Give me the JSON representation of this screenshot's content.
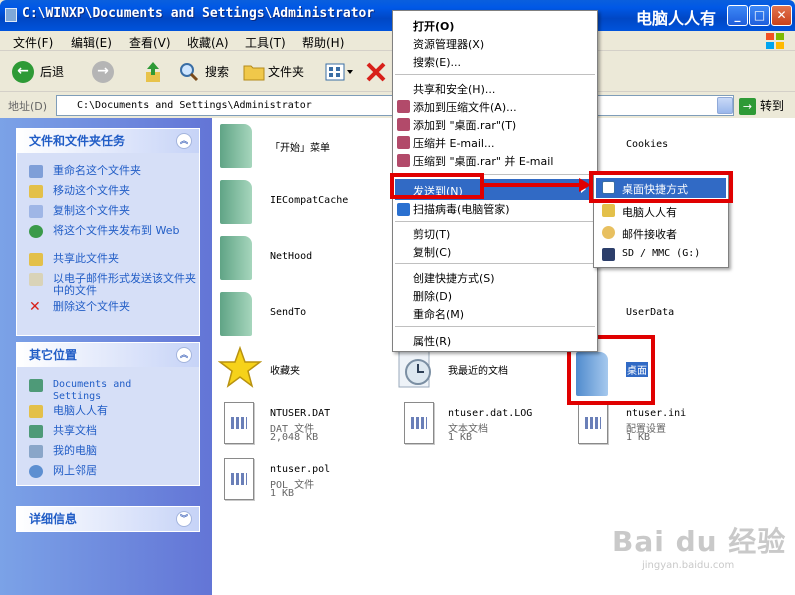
{
  "window": {
    "title": "C:\\WINXP\\Documents and Settings\\Administrator",
    "brand": "电脑人人有",
    "min_label": "_",
    "max_label": "□",
    "close_label": "✕"
  },
  "menubar": [
    "文件(F)",
    "编辑(E)",
    "查看(V)",
    "收藏(A)",
    "工具(T)",
    "帮助(H)"
  ],
  "toolbar": {
    "back": "后退",
    "search": "搜索",
    "folders": "文件夹"
  },
  "address": {
    "label": "地址(D)",
    "value": "C:\\Documents and Settings\\Administrator",
    "go": "转到"
  },
  "tasks_panel": {
    "title": "文件和文件夹任务",
    "items": [
      "重命名这个文件夹",
      "移动这个文件夹",
      "复制这个文件夹",
      "将这个文件夹发布到 Web",
      "共享此文件夹",
      "以电子邮件形式发送该文件夹中的文件",
      "删除这个文件夹"
    ]
  },
  "other_places": {
    "title": "其它位置",
    "items": [
      "Documents and Settings",
      "电脑人人有",
      "共享文档",
      "我的电脑",
      "网上邻居"
    ]
  },
  "details": {
    "title": "详细信息"
  },
  "files": [
    {
      "name": "「开始」菜单"
    },
    {
      "name": "Cookies"
    },
    {
      "name": "IECompatCache"
    },
    {
      "name": "NetHood"
    },
    {
      "name": "SendTo"
    },
    {
      "name": "UserData"
    },
    {
      "name": "收藏夹"
    },
    {
      "name": "我最近的文档"
    },
    {
      "name": "桌面"
    },
    {
      "name": "NTUSER.DAT",
      "type": "DAT 文件",
      "size": "2,048 KB"
    },
    {
      "name": "ntuser.dat.LOG",
      "type": "文本文档",
      "size": "1 KB"
    },
    {
      "name": "ntuser.ini",
      "type": "配置设置",
      "size": "1 KB"
    },
    {
      "name": "ntuser.pol",
      "type": "POL 文件",
      "size": "1 KB"
    }
  ],
  "context_menu": {
    "items": [
      "打开(O)",
      "资源管理器(X)",
      "搜索(E)...",
      "共享和安全(H)...",
      "添加到压缩文件(A)...",
      "添加到 \"桌面.rar\"(T)",
      "压缩并 E-mail...",
      "压缩到 \"桌面.rar\" 并 E-mail",
      "发送到(N)",
      "扫描病毒(电脑管家)",
      "剪切(T)",
      "复制(C)",
      "创建快捷方式(S)",
      "删除(D)",
      "重命名(M)",
      "属性(R)"
    ]
  },
  "sendto_menu": {
    "items": [
      "桌面快捷方式",
      "电脑人人有",
      "邮件接收者",
      "SD / MMC (G:)"
    ]
  },
  "watermark": {
    "main": "Bai du 经验",
    "sub": "jingyan.baidu.com"
  },
  "colors": {
    "titlebar": "#0058e6",
    "highlight": "#316ac5",
    "annotation_red": "#e00000",
    "sidebar": "#6375d6"
  }
}
